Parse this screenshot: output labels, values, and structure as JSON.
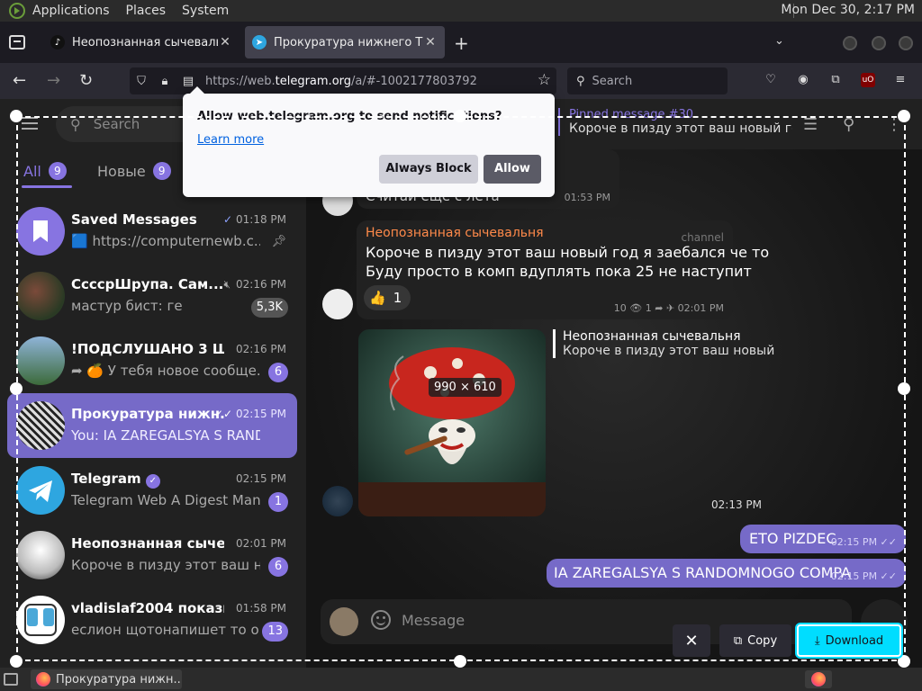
{
  "system_panel": {
    "menus": [
      "Applications",
      "Places",
      "System"
    ],
    "clock": "Mon Dec 30,  2:17 PM"
  },
  "browser": {
    "tabs": [
      {
        "title": "Неопознанная сычевальн",
        "favicon": "tiktok-icon"
      },
      {
        "title": "Прокуратура нижнего Тагі",
        "favicon": "telegram-icon"
      }
    ],
    "url_prefix": "https://web.",
    "url_domain": "telegram.org",
    "url_suffix": "/a/#-1002177803792",
    "search_placeholder": "Search"
  },
  "notification": {
    "question": "Allow web.telegram.org to send notifications?",
    "learn_more": "Learn more",
    "block_label": "Always Block",
    "allow_label": "Allow"
  },
  "sidebar": {
    "search_placeholder": "Search",
    "filters": [
      {
        "label": "All",
        "count": "9"
      },
      {
        "label": "Новые",
        "count": "9"
      }
    ],
    "chats": [
      {
        "name": "Saved Messages",
        "time": "01:18 PM",
        "preview": "🟦 https://computernewb.c...",
        "badge": "",
        "ticks": "✓"
      },
      {
        "name": "СсссрШрупа. Сам...",
        "time": "02:16 PM",
        "preview": "мастур бист: ге",
        "badge": "5,3K",
        "ticks": ""
      },
      {
        "name": "!ПОДСЛУШАНО 3 ШК...",
        "time": "02:16 PM",
        "preview": "➦ 🍊 У тебя новое сообще...",
        "badge": "6",
        "ticks": ""
      },
      {
        "name": "Прокуратура нижн...",
        "time": "02:15 PM",
        "preview": "You: IA ZAREGALSYA S RANDO...",
        "badge": "",
        "ticks": "✓✓"
      },
      {
        "name": "Telegram",
        "time": "02:15 PM",
        "preview": "Telegram Web A Digest Man...",
        "badge": "1",
        "ticks": ""
      },
      {
        "name": "Неопознанная сычев...",
        "time": "02:01 PM",
        "preview": "Короче в пизду этот ваш н...",
        "badge": "6",
        "ticks": ""
      },
      {
        "name": "vladislaf2004 показыв...",
        "time": "01:58 PM",
        "preview": "еслион щотонапишет то о...",
        "badge": "13",
        "ticks": ""
      }
    ]
  },
  "chat_header": {
    "pinned_label": "Pinned message #30",
    "pinned_text": "Короче в пизду этот ваш новый го..."
  },
  "messages": {
    "partial_text": "Считай еще с лета",
    "partial_time": "01:53 PM",
    "forward_author": "Неопознанная сычевальня",
    "channel_label": "channel",
    "forward_text_1": "Короче в пизду этот ваш новый год я заебался че то",
    "forward_text_2": "Буду просто в комп вдуплять пока 25 не наступит",
    "reaction_emoji": "👍",
    "reaction_count": "1",
    "forward_meta": "10 👁  1 ➦  ✈ 02:01 PM",
    "reply_author": "Неопознанная сычевальня",
    "reply_text": "Короче в пизду этот ваш новый ...",
    "image_dims": "990 × 610",
    "image_time": "02:13 PM",
    "out_1": "ETO PIZDEC",
    "out_1_time": "02:15 PM",
    "out_2": "IA ZAREGALSYA S RANDOMNOGO COMPA",
    "out_2_time": "02:15 PM"
  },
  "composer": {
    "placeholder": "Message"
  },
  "screenshot_tool": {
    "copy_label": "Copy",
    "download_label": "Download"
  },
  "taskbar": {
    "task_title": "Прокуратура нижн..."
  }
}
